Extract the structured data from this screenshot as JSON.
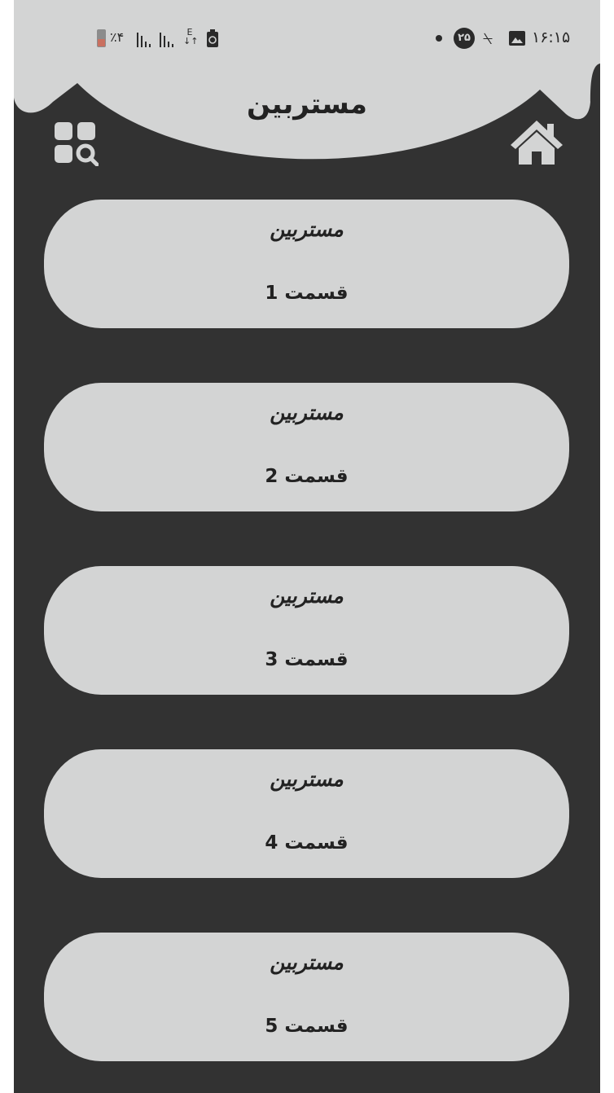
{
  "status_bar": {
    "time": "۱۶:۱۵",
    "notification_count": "۲۵",
    "battery_percent": "٪۴",
    "data_indicator": "E",
    "icons": [
      "gallery-icon",
      "alarm-icon",
      "signal-icon",
      "data-icon",
      "cleaner-icon",
      "battery-icon"
    ]
  },
  "header": {
    "title": "مستربین",
    "left_icon": "apps-search-icon",
    "right_icon": "home-icon"
  },
  "episodes": [
    {
      "title": "مستربین",
      "label": "قسمت 1"
    },
    {
      "title": "مستربین",
      "label": "قسمت 2"
    },
    {
      "title": "مستربین",
      "label": "قسمت 3"
    },
    {
      "title": "مستربین",
      "label": "قسمت 4"
    },
    {
      "title": "مستربین",
      "label": "قسمت 5"
    }
  ],
  "colors": {
    "background": "#323232",
    "surface": "#d3d4d4",
    "text": "#222222"
  }
}
